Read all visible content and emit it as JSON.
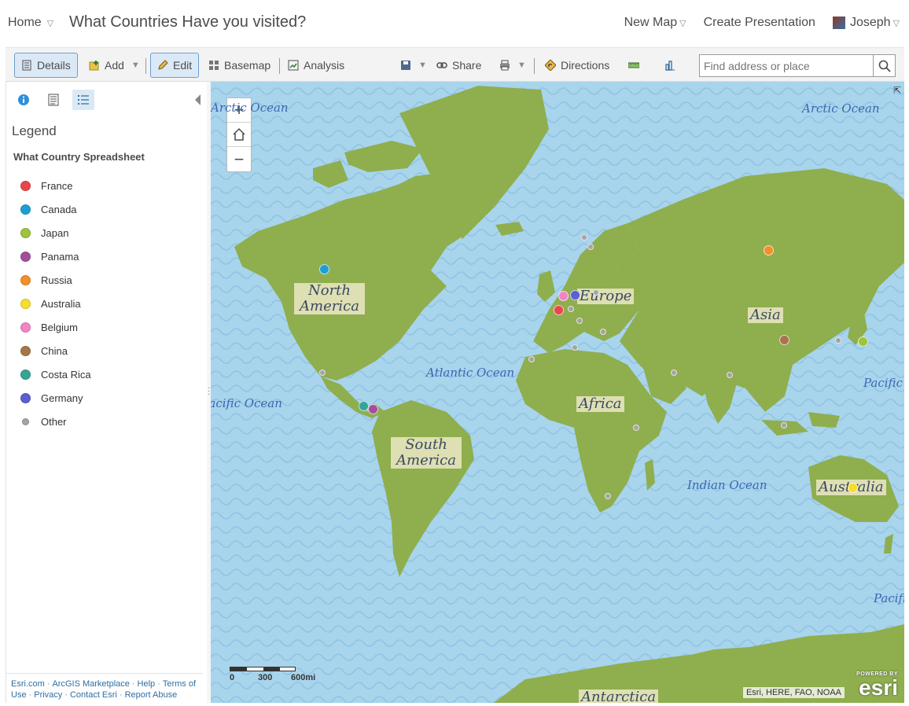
{
  "header": {
    "home_label": "Home",
    "title": "What Countries Have you visited?",
    "new_map_label": "New Map",
    "create_presentation_label": "Create Presentation",
    "user_name": "Joseph"
  },
  "toolbar": {
    "details_label": "Details",
    "add_label": "Add",
    "edit_label": "Edit",
    "basemap_label": "Basemap",
    "analysis_label": "Analysis",
    "share_label": "Share",
    "directions_label": "Directions",
    "search_placeholder": "Find address or place"
  },
  "panel": {
    "legend_title": "Legend",
    "layer_title": "What Country Spreadsheet",
    "legend_items": [
      {
        "label": "France",
        "color": "#e8474a"
      },
      {
        "label": "Canada",
        "color": "#1e9fd1"
      },
      {
        "label": "Japan",
        "color": "#9dc43b"
      },
      {
        "label": "Panama",
        "color": "#a24f99"
      },
      {
        "label": "Russia",
        "color": "#f28f2a"
      },
      {
        "label": "Australia",
        "color": "#f7dd2d"
      },
      {
        "label": "Belgium",
        "color": "#f184c4"
      },
      {
        "label": "China",
        "color": "#a8744a"
      },
      {
        "label": "Costa Rica",
        "color": "#35a595"
      },
      {
        "label": "Germany",
        "color": "#5a5fd1"
      },
      {
        "label": "Other",
        "color": "#a4a4a4"
      }
    ],
    "footer": {
      "esri_com": "Esri.com",
      "marketplace": "ArcGIS Marketplace",
      "help": "Help",
      "terms": "Terms of Use",
      "privacy": "Privacy",
      "contact": "Contact Esri",
      "report": "Report Abuse"
    }
  },
  "map": {
    "continent_labels": {
      "north_america": "North America",
      "south_america": "South America",
      "europe": "Europe",
      "asia": "Asia",
      "africa": "Africa",
      "australia": "Australia",
      "antarctica": "Antarctica"
    },
    "ocean_labels": {
      "arctic_left": "Arctic Ocean",
      "arctic_right": "Arctic Ocean",
      "atlantic": "Atlantic Ocean",
      "pacific_left": "Pacific Ocean",
      "pacific_right_top": "Pacific",
      "pacific_right_bottom": "Pacific",
      "indian": "Indian Ocean"
    },
    "scale": {
      "zero": "0",
      "mid": "300",
      "end": "600mi"
    },
    "attribution": "Esri, HERE, FAO, NOAA",
    "logo_powered": "POWERED BY",
    "logo_text": "esri"
  }
}
